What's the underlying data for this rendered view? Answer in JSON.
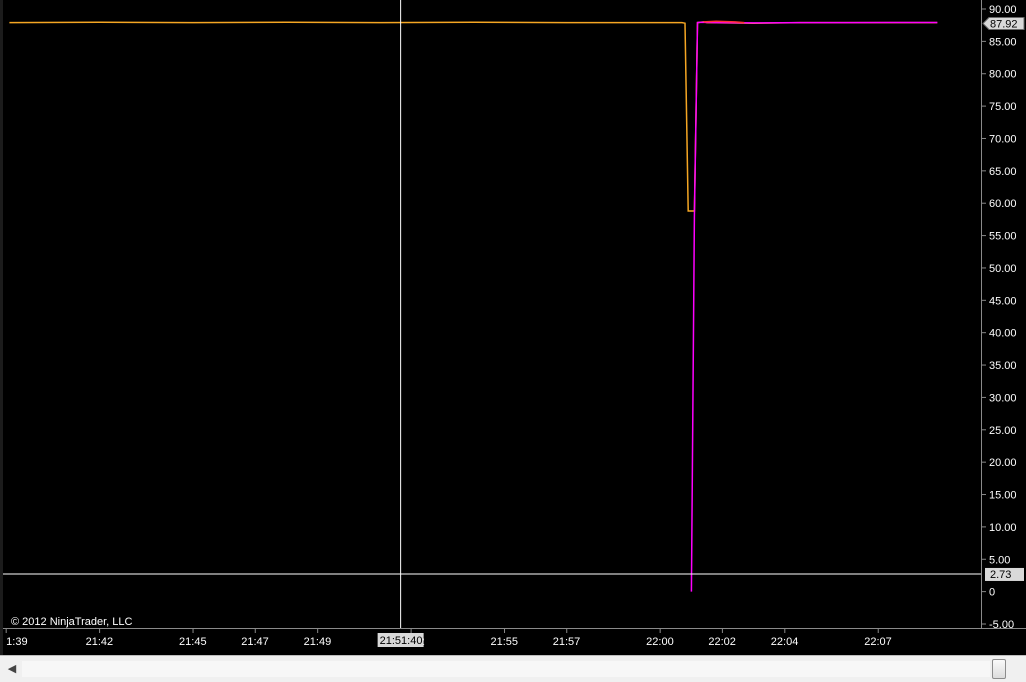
{
  "chart": {
    "copyright": "© 2012 NinjaTrader, LLC",
    "price_marker_last": "87.92",
    "crosshair_price_label": "2.73",
    "crosshair_time_label": "21:51:40",
    "colors": {
      "background": "#000000",
      "series_orange": "#f5a623",
      "series_magenta": "#ff00ff",
      "series_red": "#ff3030",
      "crosshair": "#ffffff",
      "axis_text": "#ffffff"
    }
  },
  "chart_data": {
    "type": "line",
    "title": "",
    "xlabel": "",
    "ylabel": "",
    "ylim": [
      -5,
      90
    ],
    "y_ticks": [
      "90.00",
      "85.00",
      "80.00",
      "75.00",
      "70.00",
      "65.00",
      "60.00",
      "55.00",
      "50.00",
      "45.00",
      "40.00",
      "35.00",
      "30.00",
      "25.00",
      "20.00",
      "15.00",
      "10.00",
      "5.00",
      "0",
      "-5.00"
    ],
    "y_tick_values": [
      90,
      85,
      80,
      75,
      70,
      65,
      60,
      55,
      50,
      45,
      40,
      35,
      30,
      25,
      20,
      15,
      10,
      5,
      0,
      -5
    ],
    "x_ticks": [
      "1:39",
      "21:42",
      "21:45",
      "21:47",
      "21:49",
      "21:52",
      "21:55",
      "21:57",
      "22:00",
      "22:02",
      "22:04",
      "22:07"
    ],
    "x_tick_values": [
      21.65,
      21.7,
      21.75,
      21.7833,
      21.8167,
      21.8667,
      21.9167,
      21.95,
      22.0,
      22.0333,
      22.0667,
      22.1167
    ],
    "x_range": [
      21.6483,
      22.1717
    ],
    "crosshair": {
      "x": 21.8611,
      "y": 2.73
    },
    "series": [
      {
        "color": "#f5a623",
        "x": [
          21.6517,
          21.7,
          21.75,
          21.8,
          21.85,
          21.9,
          21.95,
          22.0,
          22.0117,
          22.0133,
          22.015,
          22.0183,
          22.02,
          22.0233,
          22.025,
          22.05,
          22.075,
          22.1,
          22.1483
        ],
        "values": [
          87.9,
          87.95,
          87.9,
          87.95,
          87.9,
          87.95,
          87.9,
          87.9,
          87.9,
          87.8,
          58.8,
          58.8,
          87.9,
          88.0,
          87.9,
          87.8,
          87.9,
          87.9,
          87.9
        ]
      },
      {
        "color": "#ff00ff",
        "x": [
          22.0167,
          22.0183,
          22.02,
          22.0217,
          22.03,
          22.05,
          22.075,
          22.1,
          22.1483
        ],
        "values": [
          0.0,
          58.0,
          87.9,
          87.95,
          87.9,
          87.85,
          87.9,
          87.9,
          87.92
        ]
      },
      {
        "color": "#ff3030",
        "x": [
          22.0233,
          22.03,
          22.04,
          22.045
        ],
        "values": [
          88.0,
          88.1,
          88.0,
          87.9
        ]
      }
    ]
  }
}
